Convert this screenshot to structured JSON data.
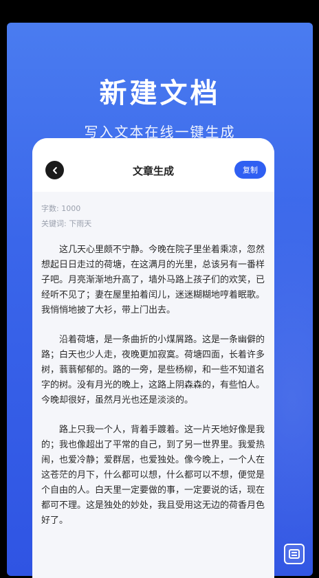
{
  "promo": {
    "headline": "新建文档",
    "subline": "写入文本在线一键生成"
  },
  "card": {
    "title": "文章生成",
    "copy_label": "复制",
    "word_count": "字数: 1000",
    "keywords": "关键词: 下雨天",
    "paragraphs": [
      "这几天心里颇不宁静。今晚在院子里坐着乘凉，忽然想起日日走过的荷塘，在这满月的光里，总该另有一番样子吧。月亮渐渐地升高了，墙外马路上孩子们的欢笑，已经听不见了；妻在屋里拍着闰儿，迷迷糊糊地哼着眠歌。我悄悄地披了大衫，带上门出去。",
      "沿着荷塘，是一条曲折的小煤屑路。这是一条幽僻的路；白天也少人走，夜晚更加寂寞。荷塘四面，长着许多树，蓊蓊郁郁的。路的一旁，是些杨柳，和一些不知道名字的树。没有月光的晚上，这路上阴森森的，有些怕人。今晚却很好，虽然月光也还是淡淡的。",
      "路上只我一个人，背着手踱着。这一片天地好像是我的；我也像超出了平常的自己，到了另一世界里。我爱热闹，也爱冷静；爱群居，也爱独处。像今晚上，一个人在这苍茫的月下，什么都可以想，什么都可以不想，便觉是个自由的人。白天里一定要做的事，一定要说的话，现在都可不理。这是独处的妙处，我且受用这无边的荷香月色好了。"
    ]
  },
  "icons": {
    "back": "chevron-left-icon",
    "floating": "note-icon"
  },
  "colors": {
    "brand_blue": "#2f5ff2",
    "background": "#3a66ea"
  }
}
